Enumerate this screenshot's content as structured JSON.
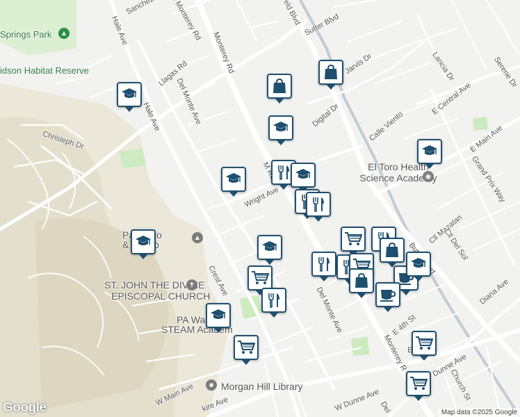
{
  "streets": {
    "sanchez": "Sanchez",
    "monterey_rd_nw": "d Monterey Rd",
    "monterey_rd_n": "Monterey Rd",
    "monterey_rd_mid": "M    Rd",
    "monterey_rd_s": "Monterey R",
    "butterfield": "eld Blvd",
    "butterfield_s": "Butter  Blvd",
    "sutter": "Sutter Blvd",
    "hale_n": "Hale Ave",
    "hale_mid": "Hale Ave",
    "llagas": "Llagas Rd",
    "del_monte_n": "Del Monte Ave",
    "del_monte_s": "Del Monte Ave",
    "christeph": "Christeph Dr",
    "jarvis": "Jarvis Dr",
    "digital": "Digital Dr",
    "lancia": "Lancia Dr",
    "serene": "Serene Dr",
    "e_central": "E Central Ave",
    "calle_viento": "Calle Viento",
    "e_main": "E Main Ave",
    "grand_prix": "Grand Prix Way",
    "cll_mazatan": "Cll Mazatan",
    "cll_del_sol": "Cll Del Sol",
    "wright": "Wright Ave",
    "crest": "Crest Ave",
    "diana": "Diana Ave",
    "e_4th": "E 4th St",
    "dunne": "Dunne Ave",
    "w_dunne": "W Dunne Ave",
    "church": "Church St",
    "w_main": "W Main Ave",
    "e_short": "E",
    "kire": "kire Ave",
    "del_s": "Del"
  },
  "places": {
    "springs_park": "Springs Park",
    "habitat": "idson Habitat Reserve",
    "el_toro": "El Toro Health Science Academy",
    "piano_1": "Pa    Piano",
    "piano_2": "&      Studio",
    "st_john_1": "ST. JOHN THE DIVINE",
    "st_john_2": "EPISCOPAL CHURCH",
    "steam_1": "PA Wa",
    "steam_2": "STEAM Academ",
    "library": "Morgan Hill Library"
  },
  "pins": [
    {
      "type": "school"
    },
    {
      "type": "shopping"
    },
    {
      "type": "shopping"
    },
    {
      "type": "school"
    },
    {
      "type": "school"
    },
    {
      "type": "restaurant"
    },
    {
      "type": "school"
    },
    {
      "type": "restaurant"
    },
    {
      "type": "restaurant"
    },
    {
      "type": "school"
    },
    {
      "type": "school"
    },
    {
      "type": "school"
    },
    {
      "type": "cart"
    },
    {
      "type": "cart"
    },
    {
      "type": "restaurant"
    },
    {
      "type": "restaurant"
    },
    {
      "type": "restaurant"
    },
    {
      "type": "shopping"
    },
    {
      "type": "restaurant"
    },
    {
      "type": "cart"
    },
    {
      "type": "shopping"
    },
    {
      "type": "coffee"
    },
    {
      "type": "coffee"
    },
    {
      "type": "school"
    },
    {
      "type": "school"
    },
    {
      "type": "cart"
    },
    {
      "type": "cart"
    },
    {
      "type": "cart"
    }
  ],
  "footer": {
    "logo": "Google",
    "attribution": "Map data ©2025 Google"
  },
  "colors": {
    "pin_border": "#1f4f6e",
    "park_green": "#cdeac0",
    "hill": "#e9e5d6",
    "road": "#ffffff",
    "rail": "#c2cbd4"
  }
}
